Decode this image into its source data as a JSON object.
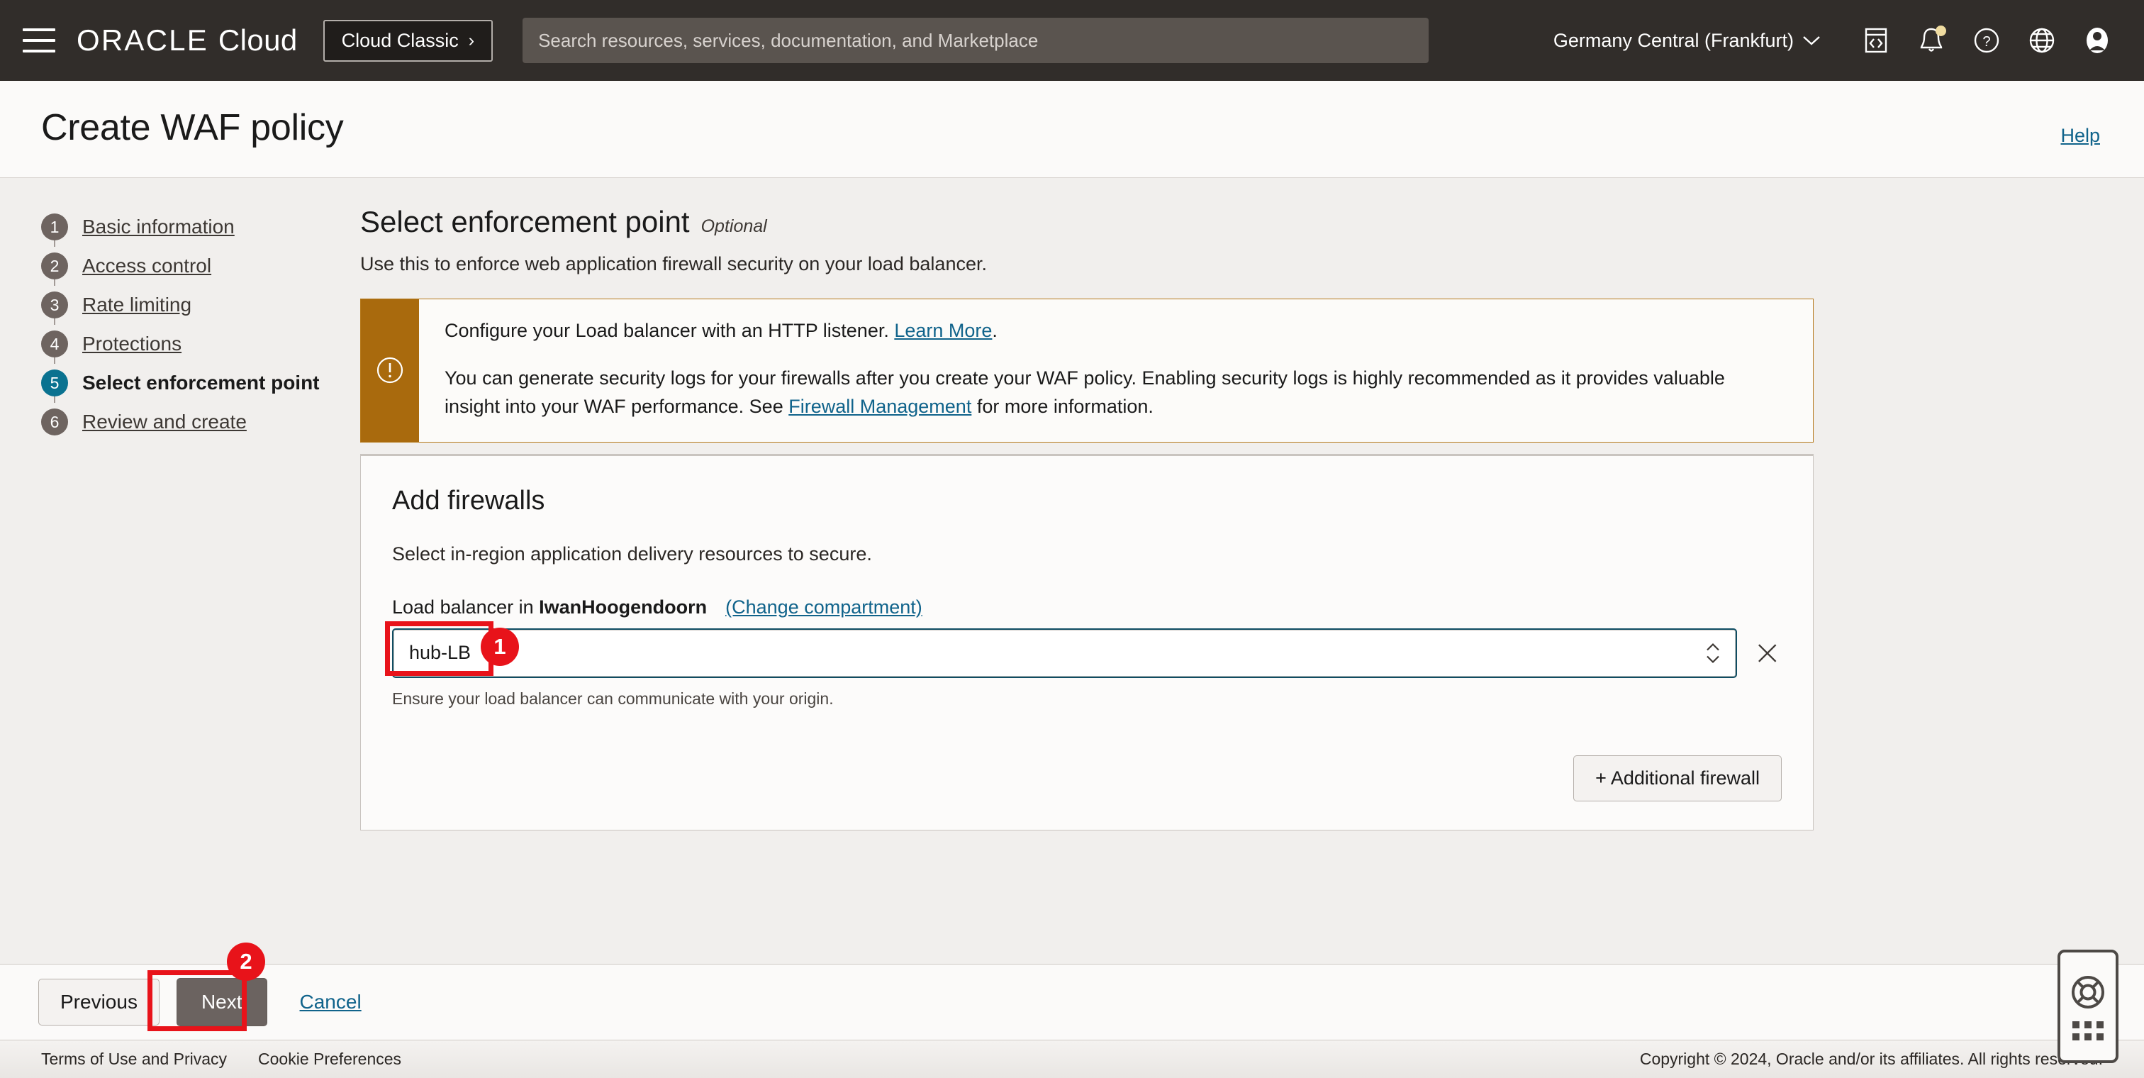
{
  "header": {
    "menu_icon": "hamburger-icon",
    "brand_oracle": "ORACLE",
    "brand_cloud": "Cloud",
    "cloud_classic_label": "Cloud Classic",
    "cloud_classic_chevron": "›",
    "search_placeholder": "Search resources, services, documentation, and Marketplace",
    "search_value": "",
    "region": "Germany Central (Frankfurt)",
    "region_chevron": "⌄",
    "icons": [
      "cloud-shell-icon",
      "notifications-bell-icon",
      "help-question-icon",
      "language-globe-icon",
      "user-avatar-icon"
    ]
  },
  "page": {
    "title": "Create WAF policy",
    "help_link": "Help"
  },
  "steps": [
    {
      "num": "1",
      "label": "Basic information",
      "active": false
    },
    {
      "num": "2",
      "label": "Access control",
      "active": false
    },
    {
      "num": "3",
      "label": "Rate limiting",
      "active": false
    },
    {
      "num": "4",
      "label": "Protections",
      "active": false
    },
    {
      "num": "5",
      "label": "Select enforcement point",
      "active": true
    },
    {
      "num": "6",
      "label": "Review and create",
      "active": false
    }
  ],
  "section": {
    "title": "Select enforcement point",
    "optional": "Optional",
    "subtitle": "Use this to enforce web application firewall security on your load balancer."
  },
  "warning": {
    "icon": "alert-exclamation-icon",
    "line1_pre": "Configure your Load balancer with an HTTP listener. ",
    "line1_link": "Learn More",
    "line1_post": ".",
    "line2_pre": "You can generate security logs for your firewalls after you create your WAF policy. Enabling security logs is highly recommended as it provides valuable insight into your WAF performance. See ",
    "line2_link": "Firewall Management",
    "line2_post": " for more information."
  },
  "card": {
    "title": "Add firewalls",
    "subtitle": "Select in-region application delivery resources to secure.",
    "lb_label_pre": "Load balancer in ",
    "lb_compartment": "IwanHoogendoorn",
    "change_compartment_link": "(Change compartment)",
    "select_value": "hub-LB",
    "field_hint": "Ensure your load balancer can communicate with your origin.",
    "clear_icon": "close-x-icon",
    "stepper_icon": "chevron-up-down-icon",
    "additional_firewall_label": "+ Additional firewall"
  },
  "annotations": [
    {
      "badge": "1",
      "target": "load-balancer-select"
    },
    {
      "badge": "2",
      "target": "next-button"
    }
  ],
  "support_widget": {
    "icon": "life-ring-icon",
    "drag_handle": "dot-grid-icon"
  },
  "actions": {
    "previous": "Previous",
    "next": "Next",
    "cancel": "Cancel"
  },
  "footer": {
    "terms": "Terms of Use and Privacy",
    "cookies": "Cookie Preferences",
    "copyright": "Copyright © 2024, Oracle and/or its affiliates. All rights reserved."
  },
  "colors": {
    "header_bg": "#312d2a",
    "active_step": "#0a7290",
    "warning_bar": "#a96a0d",
    "link": "#10638b",
    "annotation_red": "#e8131a",
    "next_button": "#6b6360"
  }
}
